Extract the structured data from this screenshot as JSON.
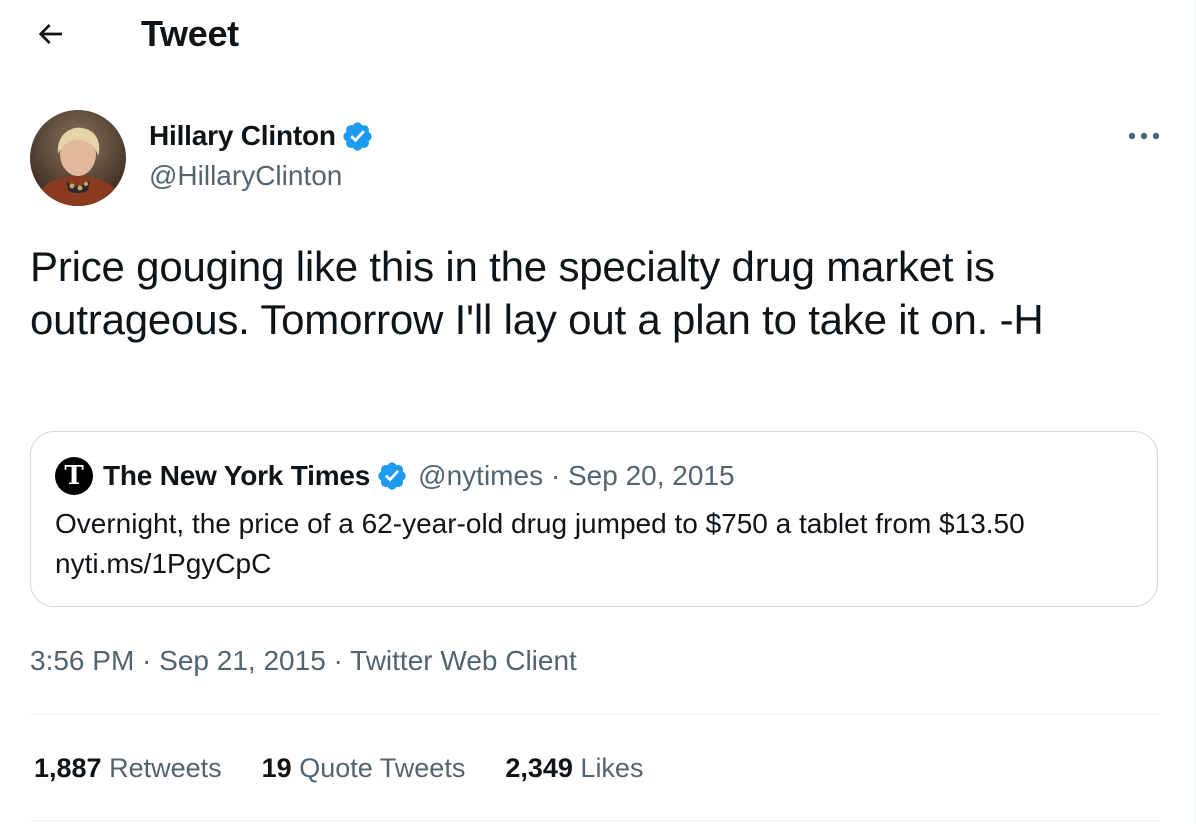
{
  "header": {
    "title": "Tweet"
  },
  "author": {
    "name": "Hillary Clinton",
    "handle": "@HillaryClinton"
  },
  "tweet": {
    "text": "Price gouging like this in the specialty drug market is outrageous. Tomorrow I'll lay out a plan to take it on. -H"
  },
  "quote": {
    "name": "The New York Times",
    "handle": "@nytimes",
    "separator": " · ",
    "date": "Sep 20, 2015",
    "text": "Overnight, the price of a 62-year-old drug jumped to $750 a tablet from $13.50",
    "link": "nyti.ms/1PgyCpC",
    "logo_glyph": "T"
  },
  "meta": {
    "time": "3:56 PM",
    "separator": " · ",
    "date": "Sep 21, 2015",
    "source": "Twitter Web Client"
  },
  "stats": [
    {
      "count": "1,887",
      "label": "Retweets"
    },
    {
      "count": "19",
      "label": "Quote Tweets"
    },
    {
      "count": "2,349",
      "label": "Likes"
    }
  ],
  "icons": {
    "back": "arrow-left-icon",
    "verified": "verified-badge-icon",
    "more": "more-dots-icon"
  },
  "colors": {
    "text_primary": "#0f1419",
    "text_secondary": "#536471",
    "verified_blue": "#1d9bf0",
    "border": "#cfd9de",
    "divider": "#eff3f4"
  }
}
